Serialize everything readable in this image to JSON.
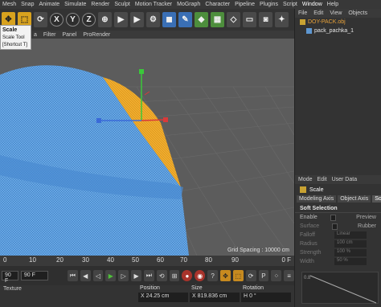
{
  "menu": [
    "Mesh",
    "Snap",
    "Animate",
    "Simulate",
    "Render",
    "Sculpt",
    "Motion Tracker",
    "MoGraph",
    "Character",
    "Pipeline",
    "Plugins",
    "Script",
    "Window",
    "Help"
  ],
  "toolbar": {
    "axis_x": "X",
    "axis_y": "Y",
    "axis_z": "Z"
  },
  "tooltip": {
    "title": "Scale",
    "line1": "Scale Tool",
    "line2": "[Shortcut T]"
  },
  "viewmenu": [
    "a",
    "Filter",
    "Panel",
    "ProRender"
  ],
  "viewport": {
    "grid_spacing": "Grid Spacing : 10000 cm",
    "colors": {
      "background": "#5c5c5c",
      "mesh": "#5a9fe0",
      "highlight": "#e8a22a"
    }
  },
  "timeline": {
    "ticks": [
      "0",
      "10",
      "20",
      "30",
      "40",
      "50",
      "60",
      "70",
      "80",
      "90"
    ],
    "current_frame": "0 F"
  },
  "transport": {
    "start_field": "90 F",
    "end_field": "90 F"
  },
  "bottom": {
    "tabs": [
      "Texture"
    ],
    "coord_headers": [
      "Position",
      "Size",
      "Rotation"
    ],
    "position_x_label": "X",
    "position_x": "24.25 cm",
    "size_x_label": "X",
    "size_x": "819.836 cm",
    "rotation_h_label": "H",
    "rotation_h": "0 °"
  },
  "object_manager": {
    "tabs": [
      "File",
      "Edit",
      "View",
      "Objects"
    ],
    "items": [
      {
        "label": "DOY-PACK.obj",
        "icon": "null-object-icon"
      },
      {
        "label": "pack_pachka_1",
        "icon": "polygon-object-icon"
      }
    ]
  },
  "attribute_manager": {
    "tabs": [
      "Mode",
      "Edit",
      "User Data"
    ],
    "title": "Scale",
    "subtabs": [
      "Modeling Axis",
      "Object Axis",
      "So"
    ],
    "section": "Soft Selection",
    "props": [
      {
        "label": "Enable",
        "right": "Preview"
      },
      {
        "label": "Surface",
        "right": "Rubber"
      },
      {
        "label": "Falloff",
        "value": "Linear"
      },
      {
        "label": "Radius",
        "value": "100 cm"
      },
      {
        "label": "Strength",
        "value": "100 %"
      },
      {
        "label": "Width",
        "value": "50 %"
      }
    ],
    "graph_tick": "0.8"
  }
}
